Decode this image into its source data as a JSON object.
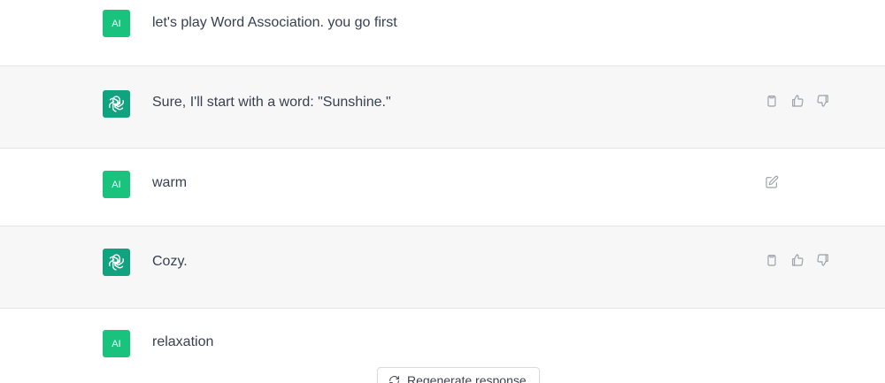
{
  "conversation": {
    "messages": [
      {
        "role": "user",
        "avatar_label": "AI",
        "text": "let's play Word Association. you go first"
      },
      {
        "role": "assistant",
        "avatar_icon": "openai-logo-icon",
        "text": "Sure, I'll start with a word: \"Sunshine.\""
      },
      {
        "role": "user",
        "avatar_label": "AI",
        "text": "warm"
      },
      {
        "role": "assistant",
        "avatar_icon": "openai-logo-icon",
        "text": "Cozy."
      },
      {
        "role": "user",
        "avatar_label": "AI",
        "text": "relaxation"
      }
    ]
  },
  "actions": {
    "assistant_icons": [
      "clipboard-icon",
      "thumbs-up-icon",
      "thumbs-down-icon"
    ],
    "user_icons": [
      "edit-icon"
    ]
  },
  "regenerate": {
    "label": "Regenerate response",
    "icon": "refresh-icon"
  },
  "colors": {
    "user_avatar": "#19c37d",
    "assistant_avatar": "#10a37f",
    "assistant_bg": "#f7f7f8",
    "icon_gray": "#9aa0a6"
  }
}
